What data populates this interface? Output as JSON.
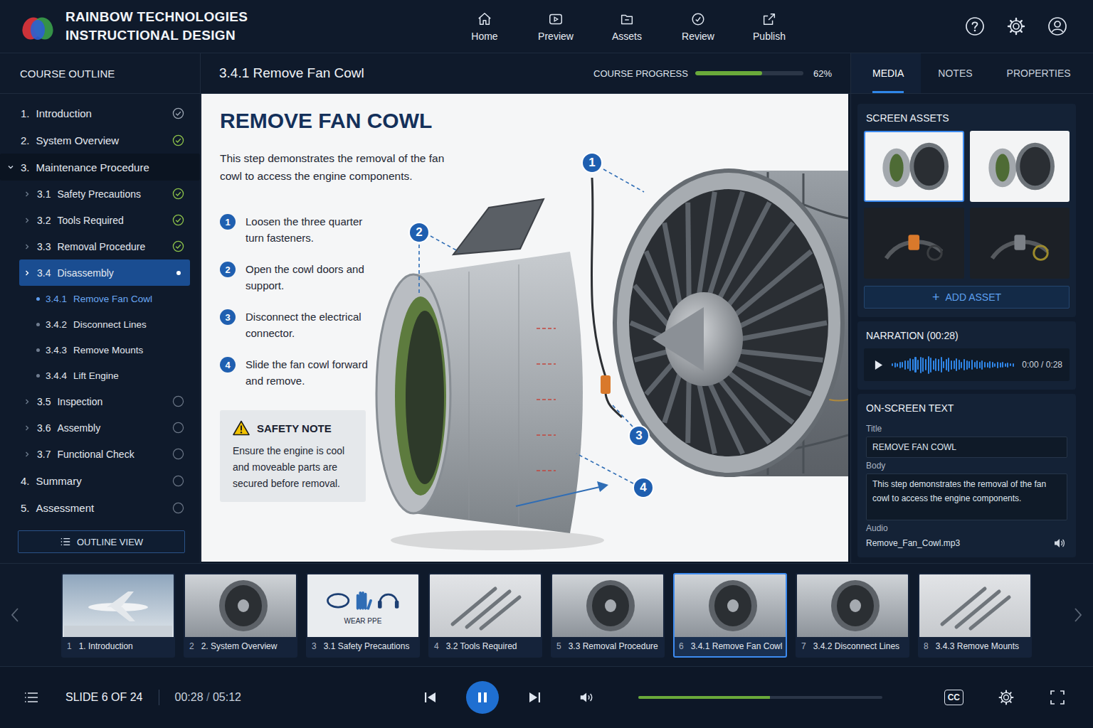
{
  "brand": {
    "line1": "RAINBOW TECHNOLOGIES",
    "line2": "INSTRUCTIONAL DESIGN"
  },
  "nav": [
    {
      "label": "Home"
    },
    {
      "label": "Preview"
    },
    {
      "label": "Assets"
    },
    {
      "label": "Review"
    },
    {
      "label": "Publish"
    }
  ],
  "outline": {
    "title": "COURSE OUTLINE",
    "items": [
      {
        "number": "1.",
        "label": "Introduction",
        "depth": 0,
        "expandable": false,
        "expanded": false,
        "status": "viewed",
        "selected": false,
        "current": false
      },
      {
        "number": "2.",
        "label": "System Overview",
        "depth": 0,
        "expandable": false,
        "expanded": false,
        "status": "complete",
        "selected": false,
        "current": false
      },
      {
        "number": "3.",
        "label": "Maintenance Procedure",
        "depth": 0,
        "expandable": true,
        "expanded": true,
        "status": "none",
        "selected": false,
        "current": false
      },
      {
        "number": "3.1",
        "label": "Safety Precautions",
        "depth": 1,
        "expandable": true,
        "expanded": false,
        "status": "complete",
        "selected": false,
        "current": false
      },
      {
        "number": "3.2",
        "label": "Tools Required",
        "depth": 1,
        "expandable": true,
        "expanded": false,
        "status": "complete",
        "selected": false,
        "current": false
      },
      {
        "number": "3.3",
        "label": "Removal Procedure",
        "depth": 1,
        "expandable": true,
        "expanded": false,
        "status": "complete",
        "selected": false,
        "current": false
      },
      {
        "number": "3.4",
        "label": "Disassembly",
        "depth": 1,
        "expandable": true,
        "expanded": false,
        "status": "active",
        "selected": true,
        "current": false
      },
      {
        "number": "3.4.1",
        "label": "Remove Fan Cowl",
        "depth": 2,
        "expandable": false,
        "expanded": false,
        "status": "none",
        "selected": false,
        "current": true
      },
      {
        "number": "3.4.2",
        "label": "Disconnect Lines",
        "depth": 2,
        "expandable": false,
        "expanded": false,
        "status": "none",
        "selected": false,
        "current": false
      },
      {
        "number": "3.4.3",
        "label": "Remove Mounts",
        "depth": 2,
        "expandable": false,
        "expanded": false,
        "status": "none",
        "selected": false,
        "current": false
      },
      {
        "number": "3.4.4",
        "label": "Lift Engine",
        "depth": 2,
        "expandable": false,
        "expanded": false,
        "status": "none",
        "selected": false,
        "current": false
      },
      {
        "number": "3.5",
        "label": "Inspection",
        "depth": 1,
        "expandable": true,
        "expanded": false,
        "status": "pending",
        "selected": false,
        "current": false
      },
      {
        "number": "3.6",
        "label": "Assembly",
        "depth": 1,
        "expandable": true,
        "expanded": false,
        "status": "pending",
        "selected": false,
        "current": false
      },
      {
        "number": "3.7",
        "label": "Functional Check",
        "depth": 1,
        "expandable": true,
        "expanded": false,
        "status": "pending",
        "selected": false,
        "current": false
      },
      {
        "number": "4.",
        "label": "Summary",
        "depth": 0,
        "expandable": false,
        "expanded": false,
        "status": "pending",
        "selected": false,
        "current": false
      },
      {
        "number": "5.",
        "label": "Assessment",
        "depth": 0,
        "expandable": false,
        "expanded": false,
        "status": "pending",
        "selected": false,
        "current": false
      }
    ],
    "button": "OUTLINE VIEW"
  },
  "header": {
    "title": "3.4.1 Remove Fan Cowl",
    "progress_label": "COURSE PROGRESS",
    "progress_level": 0.62,
    "progress_reading": "62%"
  },
  "slide": {
    "title": "REMOVE FAN COWL",
    "intro": "This step demonstrates the removal of the fan cowl to access the engine components.",
    "steps": [
      {
        "number": "1",
        "text": "Loosen the three quarter turn fasteners."
      },
      {
        "number": "2",
        "text": "Open the cowl doors and support."
      },
      {
        "number": "3",
        "text": "Disconnect the electrical connector."
      },
      {
        "number": "4",
        "text": "Slide the fan cowl forward and remove."
      }
    ],
    "safety": {
      "title": "SAFETY NOTE",
      "text": "Ensure the engine is cool and moveable parts are secured before removal."
    },
    "callouts": [
      "1",
      "2",
      "3",
      "4"
    ]
  },
  "panel": {
    "tabs": [
      {
        "label": "MEDIA",
        "selected": true
      },
      {
        "label": "NOTES",
        "selected": false
      },
      {
        "label": "PROPERTIES",
        "selected": false
      }
    ],
    "assets": {
      "title": "SCREEN ASSETS",
      "items": [
        {
          "kind": "light",
          "selected": true
        },
        {
          "kind": "light",
          "selected": false
        },
        {
          "kind": "dark",
          "selected": false
        },
        {
          "kind": "dark",
          "selected": false
        }
      ],
      "add_icon": "+",
      "add_label": "ADD ASSET"
    },
    "narration": {
      "title": "NARRATION (00:28)",
      "playing": false,
      "level": 0,
      "time": "0:00 / 0:28",
      "waveform": [
        0.15,
        0.25,
        0.2,
        0.35,
        0.3,
        0.5,
        0.45,
        0.7,
        0.6,
        0.85,
        0.55,
        0.9,
        0.75,
        0.6,
        0.95,
        0.8,
        0.5,
        0.7,
        0.65,
        0.85,
        0.4,
        0.6,
        0.75,
        0.5,
        0.45,
        0.7,
        0.55,
        0.35,
        0.6,
        0.5,
        0.4,
        0.55,
        0.3,
        0.45,
        0.35,
        0.5,
        0.3,
        0.25,
        0.4,
        0.3,
        0.2,
        0.35,
        0.25,
        0.3,
        0.2,
        0.25,
        0.15,
        0.2
      ]
    },
    "onscreen": {
      "title": "ON-SCREEN TEXT",
      "fields": [
        {
          "label": "Title",
          "value": "REMOVE FAN COWL",
          "kind": "input"
        },
        {
          "label": "Body",
          "value": "This step demonstrates the removal of the fan cowl to access the engine components.",
          "kind": "textarea"
        },
        {
          "label": "Audio",
          "value": "Remove_Fan_Cowl.mp3",
          "kind": "file"
        }
      ]
    }
  },
  "filmstrip": {
    "items": [
      {
        "number": "1",
        "label": "1. Introduction",
        "kind": "sky",
        "selected": false
      },
      {
        "number": "2",
        "label": "2. System Overview",
        "kind": "metal",
        "selected": false
      },
      {
        "number": "3",
        "label": "3.1 Safety Precautions",
        "kind": "graphic",
        "caption": "WEAR PPE",
        "selected": false
      },
      {
        "number": "4",
        "label": "3.2 Tools Required",
        "kind": "tools",
        "selected": false
      },
      {
        "number": "5",
        "label": "3.3 Removal Procedure",
        "kind": "metal",
        "selected": false
      },
      {
        "number": "6",
        "label": "3.4.1 Remove Fan Cowl",
        "kind": "metal",
        "selected": true
      },
      {
        "number": "7",
        "label": "3.4.2 Disconnect Lines",
        "kind": "metal",
        "selected": false
      },
      {
        "number": "8",
        "label": "3.4.3 Remove Mounts",
        "kind": "tools",
        "selected": false
      }
    ]
  },
  "player": {
    "slide_label": "SLIDE 6 OF 24",
    "elapsed": "00:28",
    "separator": "/",
    "total": "05:12",
    "playing": true,
    "level": 0.54,
    "cc": "CC"
  }
}
